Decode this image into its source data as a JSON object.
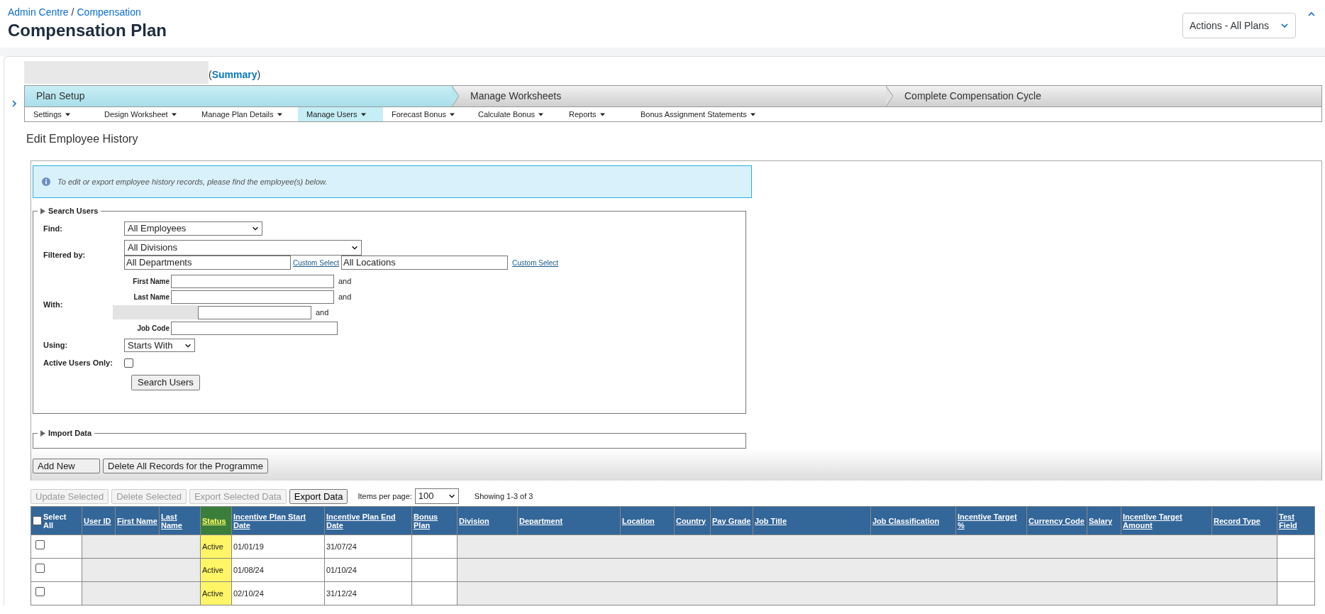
{
  "breadcrumb": [
    "Admin Centre",
    "Compensation"
  ],
  "breadcrumb_separator": "/",
  "title": "Compensation Plan",
  "actions_button": "Actions - All Plans",
  "plan": {
    "name_redacted": true,
    "open_paren": "(",
    "summary_link": "Summary",
    "close_paren": ")"
  },
  "process_steps": [
    {
      "label": "Plan Setup",
      "selected": true
    },
    {
      "label": "Manage Worksheets",
      "selected": false
    },
    {
      "label": "Complete Compensation Cycle",
      "selected": false
    }
  ],
  "submenu": [
    {
      "label": "Settings",
      "selected": false
    },
    {
      "label": "Design Worksheet",
      "selected": false
    },
    {
      "label": "Manage Plan Details",
      "selected": false
    },
    {
      "label": "Manage Users",
      "selected": true
    },
    {
      "label": "Forecast Bonus",
      "selected": false
    },
    {
      "label": "Calculate Bonus",
      "selected": false
    },
    {
      "label": "Reports",
      "selected": false
    },
    {
      "label": "Bonus Assignment Statements",
      "selected": false
    }
  ],
  "section_title": "Edit Employee History",
  "info_message": "To edit or export employee history records, please find the employee(s) below.",
  "search_users": {
    "legend": "Search Users",
    "find_label": "Find:",
    "find_value": "All Employees",
    "filtered_label": "Filtered by:",
    "division_value": "All Divisions",
    "department_value": "All Departments",
    "location_value": "All Locations",
    "custom_select": [
      "Custom Select",
      "Custom Select"
    ],
    "with_label": "With:",
    "with_fields": [
      {
        "kind": "text",
        "label": "First Name",
        "joiner": "and"
      },
      {
        "kind": "text",
        "label": "Last Name",
        "joiner": "and"
      },
      {
        "kind": "redacted",
        "joiner": "and"
      },
      {
        "kind": "text",
        "label": "Job Code"
      }
    ],
    "using_label": "Using:",
    "using_value": "Starts With",
    "active_label": "Active Users Only:",
    "active_checked": false,
    "search_button": "Search Users"
  },
  "import_data": {
    "legend": "Import Data"
  },
  "record_buttons": [
    "Add New",
    "Delete All Records for the Programme"
  ],
  "toolbar": {
    "buttons": [
      {
        "label": "Update Selected",
        "disabled": true
      },
      {
        "label": "Delete Selected",
        "disabled": true
      },
      {
        "label": "Export Selected Data",
        "disabled": true
      },
      {
        "label": "Export Data",
        "disabled": false
      }
    ],
    "items_label": "Items per page:",
    "items_value": "100",
    "showing": "Showing 1-3 of 3"
  },
  "table": {
    "select_all_checked": false,
    "columns": [
      {
        "label": "Select All",
        "kind": "select",
        "highlighted": false
      },
      {
        "label": "User ID",
        "kind": "redacted",
        "highlighted": false
      },
      {
        "label": "First Name",
        "kind": "redacted",
        "highlighted": false
      },
      {
        "label": "Last Name",
        "kind": "redacted",
        "highlighted": false
      },
      {
        "label": "Status",
        "kind": "status",
        "highlighted": true
      },
      {
        "label": "Incentive Plan Start Date",
        "kind": "start",
        "highlighted": false
      },
      {
        "label": "Incentive Plan End Date",
        "kind": "end",
        "highlighted": false
      },
      {
        "label": "Bonus Plan",
        "kind": "empty",
        "highlighted": false
      },
      {
        "label": "Division",
        "kind": "redacted",
        "highlighted": false
      },
      {
        "label": "Department",
        "kind": "redacted",
        "highlighted": false
      },
      {
        "label": "Location",
        "kind": "redacted",
        "highlighted": false
      },
      {
        "label": "Country",
        "kind": "redacted",
        "highlighted": false
      },
      {
        "label": "Pay Grade",
        "kind": "redacted",
        "highlighted": false
      },
      {
        "label": "Job Title",
        "kind": "redacted",
        "highlighted": false
      },
      {
        "label": "Job Classification",
        "kind": "redacted",
        "highlighted": false
      },
      {
        "label": "Incentive Target %",
        "kind": "redacted",
        "highlighted": false
      },
      {
        "label": "Currency Code",
        "kind": "redacted",
        "highlighted": false
      },
      {
        "label": "Salary",
        "kind": "redacted",
        "highlighted": false
      },
      {
        "label": "Incentive Target Amount",
        "kind": "redacted",
        "highlighted": false
      },
      {
        "label": "Record Type",
        "kind": "redacted",
        "highlighted": false
      },
      {
        "label": "Test Field",
        "kind": "empty",
        "highlighted": false
      }
    ],
    "rows": [
      {
        "checked": false,
        "status": "Active",
        "start": "01/01/19",
        "end": "31/07/24"
      },
      {
        "checked": false,
        "status": "Active",
        "start": "01/08/24",
        "end": "01/10/24"
      },
      {
        "checked": false,
        "status": "Active",
        "start": "02/10/24",
        "end": "31/12/24"
      }
    ]
  }
}
